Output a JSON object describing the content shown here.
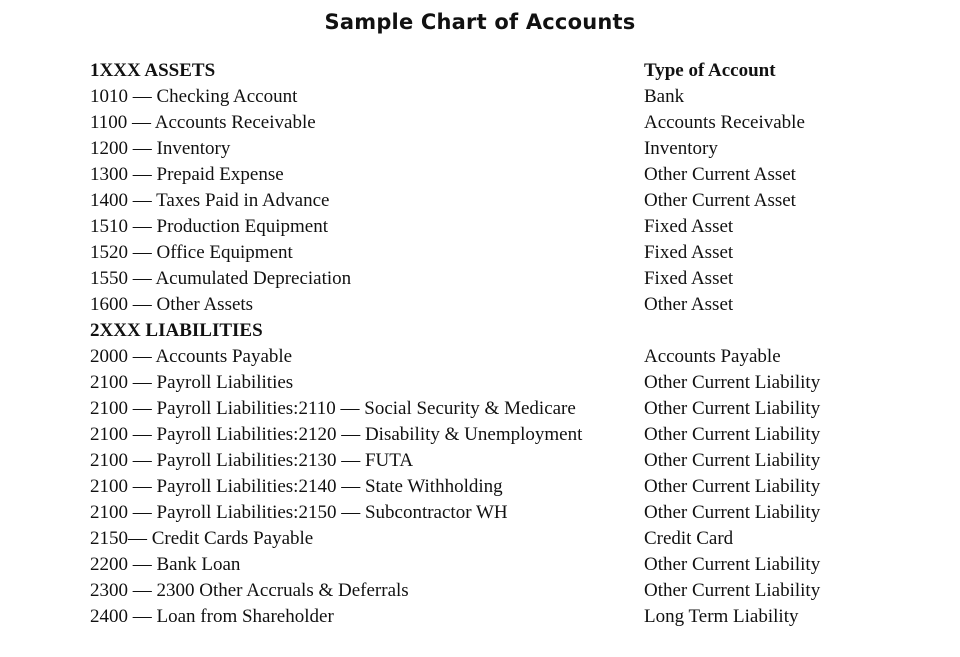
{
  "document": {
    "title": "Sample Chart of Accounts"
  },
  "table": {
    "rows": [
      {
        "type": "header",
        "account": "1XXX ASSETS",
        "account_type": "Type of Account"
      },
      {
        "type": "item",
        "account": "1010 — Checking Account",
        "account_type": "Bank"
      },
      {
        "type": "item",
        "account": "1100 — Accounts Receivable",
        "account_type": "Accounts Receivable"
      },
      {
        "type": "item",
        "account": "1200 — Inventory",
        "account_type": "Inventory"
      },
      {
        "type": "item",
        "account": "1300 — Prepaid Expense",
        "account_type": "Other Current Asset"
      },
      {
        "type": "item",
        "account": "1400 — Taxes Paid in Advance",
        "account_type": "Other Current Asset"
      },
      {
        "type": "item",
        "account": "1510 — Production Equipment",
        "account_type": "Fixed Asset"
      },
      {
        "type": "item",
        "account": "1520 — Office Equipment",
        "account_type": "Fixed Asset"
      },
      {
        "type": "item",
        "account": "1550 — Acumulated Depreciation",
        "account_type": "Fixed Asset"
      },
      {
        "type": "item",
        "account": "1600 — Other Assets",
        "account_type": "Other Asset"
      },
      {
        "type": "header",
        "account": "2XXX LIABILITIES",
        "account_type": ""
      },
      {
        "type": "item",
        "account": "2000 — Accounts Payable",
        "account_type": "Accounts Payable"
      },
      {
        "type": "item",
        "account": "2100 — Payroll Liabilities",
        "account_type": "Other Current Liability"
      },
      {
        "type": "item",
        "account": "2100 — Payroll Liabilities:2110 — Social Security & Medicare",
        "account_type": "Other Current Liability"
      },
      {
        "type": "item",
        "account": "2100 — Payroll Liabilities:2120 — Disability & Unemployment",
        "account_type": "Other Current Liability"
      },
      {
        "type": "item",
        "account": "2100 — Payroll Liabilities:2130 — FUTA",
        "account_type": "Other Current Liability"
      },
      {
        "type": "item",
        "account": "2100 — Payroll Liabilities:2140 — State Withholding",
        "account_type": "Other Current Liability"
      },
      {
        "type": "item",
        "account": "2100 — Payroll Liabilities:2150 — Subcontractor WH",
        "account_type": "Other Current Liability"
      },
      {
        "type": "item",
        "account": "2150— Credit Cards Payable",
        "account_type": "Credit Card"
      },
      {
        "type": "item",
        "account": "2200 — Bank Loan",
        "account_type": "Other Current Liability"
      },
      {
        "type": "item",
        "account": "2300 — 2300 Other Accruals & Deferrals",
        "account_type": "Other Current Liability"
      },
      {
        "type": "item",
        "account": "2400 — Loan from Shareholder",
        "account_type": "Long Term Liability"
      }
    ]
  }
}
